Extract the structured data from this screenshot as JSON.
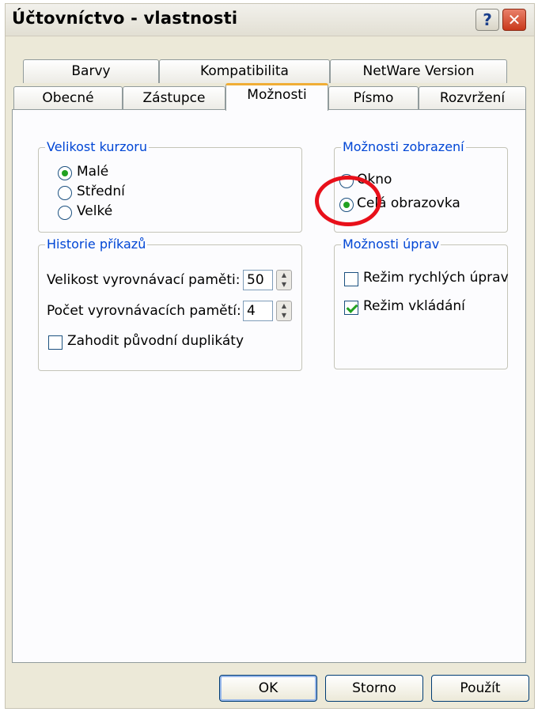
{
  "window": {
    "title": "Účtovníctvo - vlastnosti",
    "help_label": "?",
    "close_label": "✕"
  },
  "tabs_back": [
    "Barvy",
    "Kompatibilita",
    "NetWare Version"
  ],
  "tabs_front": [
    "Obecné",
    "Zástupce",
    "Možnosti",
    "Písmo",
    "Rozvržení"
  ],
  "active_tab": "Možnosti",
  "cursor_group": {
    "title": "Velikost kurzoru",
    "options": [
      "Malé",
      "Střední",
      "Velké"
    ],
    "selected": "Malé"
  },
  "display_group": {
    "title": "Možnosti zobrazení",
    "options": [
      "Okno",
      "Celá obrazovka"
    ],
    "selected": "Celá obrazovka"
  },
  "history_group": {
    "title": "Historie příkazů",
    "buffer_size_label": "Velikost vyrovnávací paměti:",
    "buffer_size_value": "50",
    "buffer_count_label": "Počet vyrovnávacích pamětí:",
    "buffer_count_value": "4",
    "discard_duplicates_label": "Zahodit původní duplikáty",
    "discard_duplicates_checked": false
  },
  "edit_group": {
    "title": "Možnosti úprav",
    "quick_edit_label": "Režim rychlých úprav",
    "quick_edit_checked": false,
    "insert_mode_label": "Režim vkládání",
    "insert_mode_checked": true
  },
  "buttons": {
    "ok": "OK",
    "cancel": "Storno",
    "apply": "Použít"
  },
  "annotation": {
    "color": "#e8101a"
  }
}
